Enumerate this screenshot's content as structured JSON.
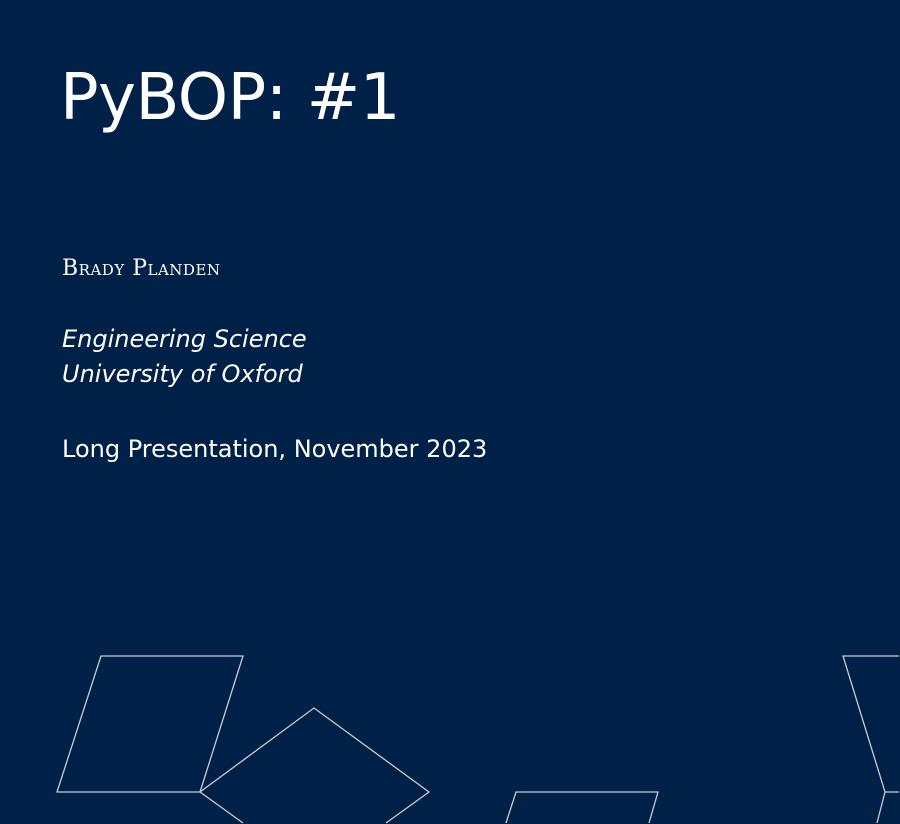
{
  "slide": {
    "title": "PyBOP: #1",
    "author": "Brady Planden",
    "department": "Engineering Science",
    "institution": "University of Oxford",
    "event_date": "Long Presentation, November 2023"
  },
  "colors": {
    "background": "#002147",
    "text": "#ffffff",
    "shape_stroke": "#c8ccd4"
  }
}
